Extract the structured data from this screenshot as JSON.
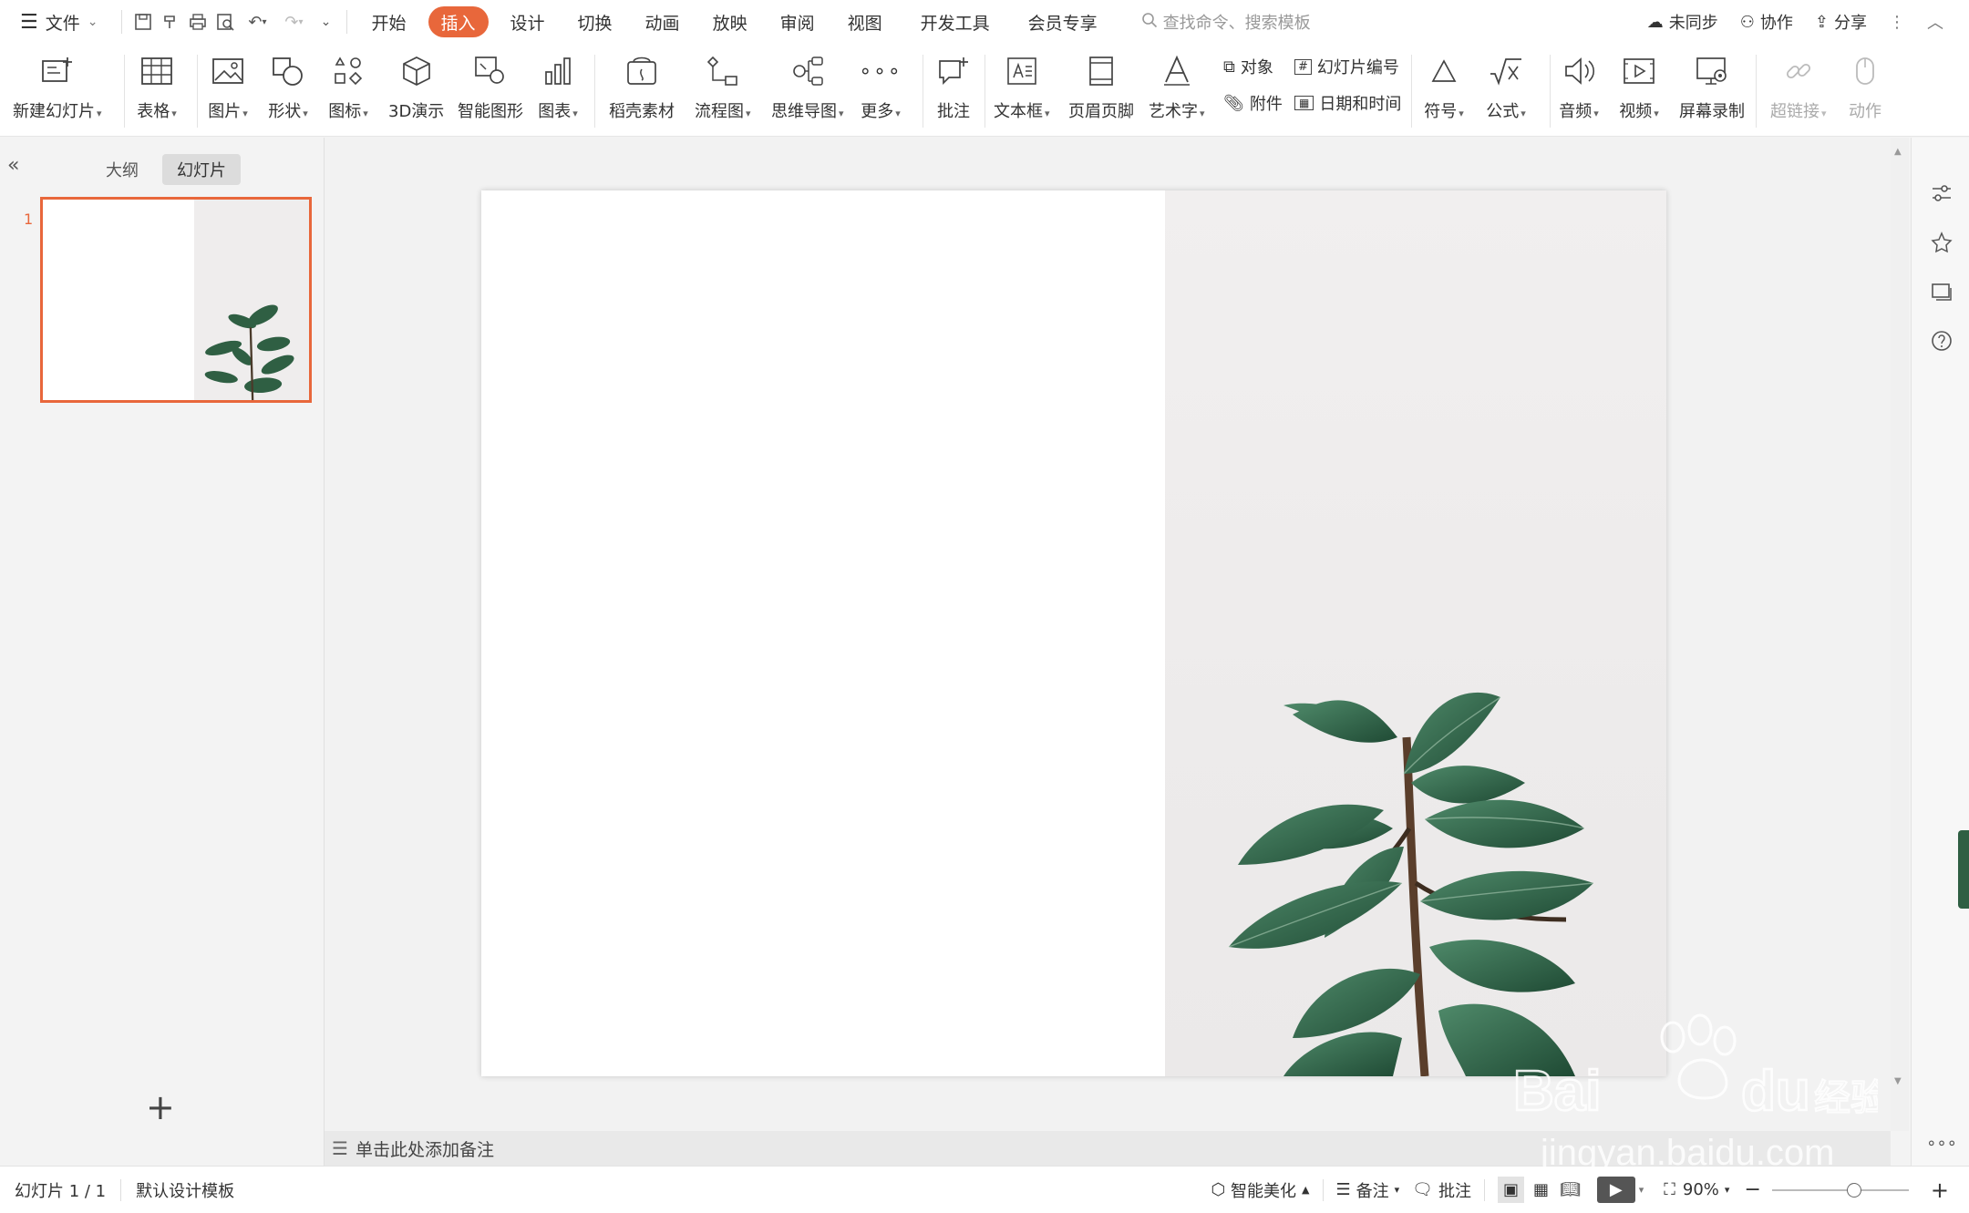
{
  "menubar": {
    "file_label": "文件",
    "tabs": [
      {
        "label": "开始"
      },
      {
        "label": "插入",
        "active": true
      },
      {
        "label": "设计"
      },
      {
        "label": "切换"
      },
      {
        "label": "动画"
      },
      {
        "label": "放映"
      },
      {
        "label": "审阅"
      },
      {
        "label": "视图"
      },
      {
        "label": "开发工具"
      },
      {
        "label": "会员专享"
      }
    ],
    "search_placeholder": "查找命令、搜索模板",
    "sync_label": "未同步",
    "collab_label": "协作",
    "share_label": "分享"
  },
  "ribbon": {
    "new_slide": "新建幻灯片",
    "table": "表格",
    "picture": "图片",
    "shape": "形状",
    "icon": "图标",
    "three_d": "3D演示",
    "smart_art": "智能图形",
    "chart": "图表",
    "docer": "稻壳素材",
    "flowchart": "流程图",
    "mindmap": "思维导图",
    "more": "更多",
    "comment": "批注",
    "textbox": "文本框",
    "header_footer": "页眉页脚",
    "wordart": "艺术字",
    "object": "对象",
    "slide_number": "幻灯片编号",
    "attachment": "附件",
    "datetime": "日期和时间",
    "symbol": "符号",
    "formula": "公式",
    "audio": "音频",
    "video": "视频",
    "screen_record": "屏幕录制",
    "hyperlink": "超链接",
    "action": "动作"
  },
  "left_panel": {
    "outline_tab": "大纲",
    "slides_tab": "幻灯片",
    "slide_number": "1",
    "add_slide": "+"
  },
  "notes_placeholder": "单击此处添加备注",
  "statusbar": {
    "slide_info": "幻灯片 1 / 1",
    "template": "默认设计模板",
    "beautify": "智能美化",
    "notes": "备注",
    "comments": "批注",
    "zoom": "90%"
  },
  "watermark": {
    "text": "Baidu经验",
    "url": "jingyan.baidu.com"
  },
  "colors": {
    "accent": "#e8673b",
    "leaf": "#2f5f43"
  }
}
